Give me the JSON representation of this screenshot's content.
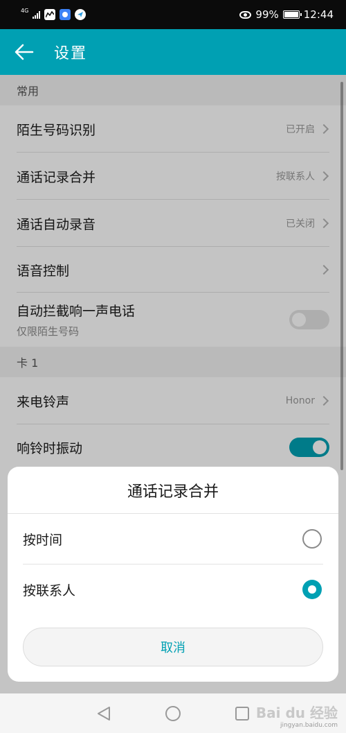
{
  "status_bar": {
    "network": "4G",
    "battery_percent": "99%",
    "battery_level": 0.99,
    "time": "12:44",
    "icons": [
      "signal-icon",
      "chart-app-icon",
      "message-app-icon",
      "send-app-icon",
      "eye-icon",
      "battery-icon"
    ]
  },
  "app_bar": {
    "title": "设置"
  },
  "sections": {
    "common": {
      "header": "常用",
      "items": [
        {
          "title": "陌生号码识别",
          "value": "已开启"
        },
        {
          "title": "通话记录合并",
          "value": "按联系人"
        },
        {
          "title": "通话自动录音",
          "value": "已关闭"
        },
        {
          "title": "语音控制",
          "value": ""
        },
        {
          "title": "自动拦截响一声电话",
          "subtitle": "仅限陌生号码",
          "toggle": false
        }
      ]
    },
    "card1": {
      "header": "卡 1",
      "items": [
        {
          "title": "来电铃声",
          "value": "Honor"
        },
        {
          "title": "响铃时振动",
          "toggle": true
        }
      ]
    }
  },
  "dialog": {
    "title": "通话记录合并",
    "options": [
      {
        "label": "按时间",
        "selected": false
      },
      {
        "label": "按联系人",
        "selected": true
      }
    ],
    "cancel_label": "取消"
  },
  "watermark": {
    "brand": "Bai du 经验",
    "url": "jingyan.baidu.com"
  },
  "colors": {
    "accent": "#00a0b3",
    "scrim": "rgba(0,0,0,0.23)"
  }
}
